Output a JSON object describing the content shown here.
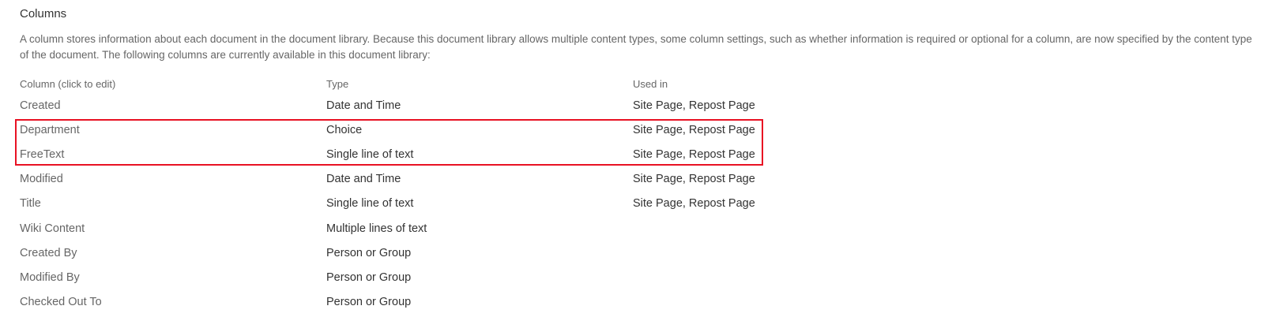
{
  "section": {
    "title": "Columns",
    "description": "A column stores information about each document in the document library. Because this document library allows multiple content types, some column settings, such as whether information is required or optional for a column, are now specified by the content type of the document. The following columns are currently available in this document library:"
  },
  "table": {
    "headers": {
      "name": "Column (click to edit)",
      "type": "Type",
      "used_in": "Used in"
    },
    "rows": [
      {
        "name": "Created",
        "type": "Date and Time",
        "used_in": "Site Page, Repost Page"
      },
      {
        "name": "Department",
        "type": "Choice",
        "used_in": "Site Page, Repost Page"
      },
      {
        "name": "FreeText",
        "type": "Single line of text",
        "used_in": "Site Page, Repost Page"
      },
      {
        "name": "Modified",
        "type": "Date and Time",
        "used_in": "Site Page, Repost Page"
      },
      {
        "name": "Title",
        "type": "Single line of text",
        "used_in": "Site Page, Repost Page"
      },
      {
        "name": "Wiki Content",
        "type": "Multiple lines of text",
        "used_in": ""
      },
      {
        "name": "Created By",
        "type": "Person or Group",
        "used_in": ""
      },
      {
        "name": "Modified By",
        "type": "Person or Group",
        "used_in": ""
      },
      {
        "name": "Checked Out To",
        "type": "Person or Group",
        "used_in": ""
      }
    ]
  },
  "highlight": {
    "color": "#e81123",
    "rows": [
      "Department",
      "FreeText"
    ]
  }
}
